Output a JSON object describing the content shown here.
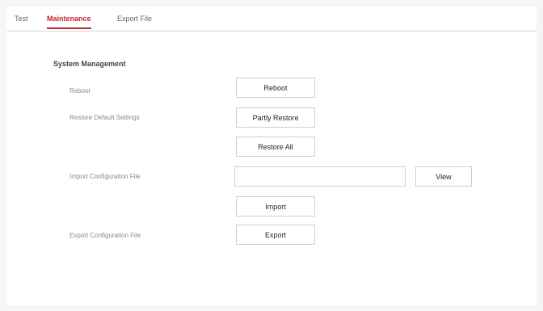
{
  "tabs": [
    {
      "label": "Test",
      "active": false
    },
    {
      "label": "Maintenance",
      "active": true
    },
    {
      "label": "Export File",
      "active": false
    }
  ],
  "system_management": {
    "title": "System Management",
    "reboot": {
      "label": "Reboot",
      "button": "Reboot"
    },
    "restore_default": {
      "label": "Restore Default Settings",
      "partly_restore_button": "Partly Restore",
      "restore_all_button": "Restore All"
    },
    "import_config": {
      "label": "Import Configuration File",
      "file_value": "",
      "view_button": "View",
      "import_button": "Import"
    },
    "export_config": {
      "label": "Export Configuration File",
      "export_button": "Export"
    }
  },
  "colors": {
    "accent": "#c0282d",
    "page_background": "#f6f6f6",
    "panel_background": "#ffffff"
  }
}
